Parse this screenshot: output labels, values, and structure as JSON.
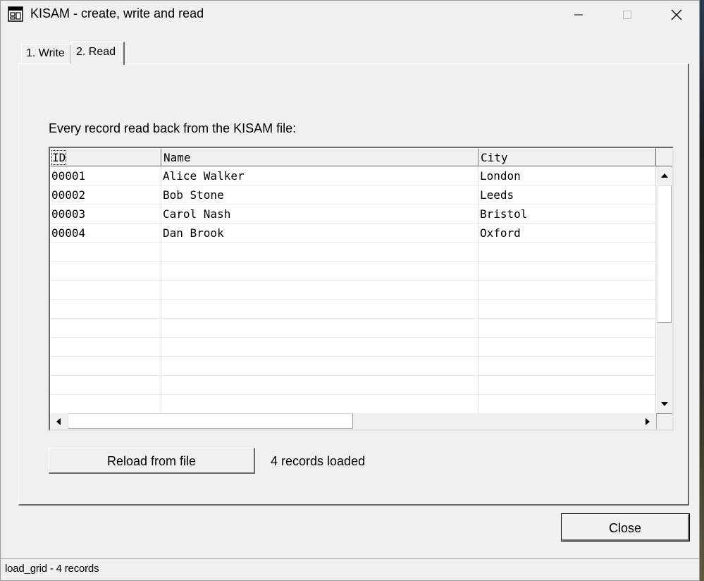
{
  "window": {
    "title": "KISAM - create, write and read"
  },
  "tabs": [
    {
      "label": "1. Write",
      "active": false
    },
    {
      "label": "2. Read",
      "active": true
    }
  ],
  "read_tab": {
    "grid_label": "Every record read back from the KISAM file:",
    "columns": [
      "ID",
      "Name",
      "City"
    ],
    "rows": [
      [
        "00001",
        "Alice Walker",
        "London"
      ],
      [
        "00002",
        "Bob Stone",
        "Leeds"
      ],
      [
        "00003",
        "Carol Nash",
        "Bristol"
      ],
      [
        "00004",
        "Dan Brook",
        "Oxford"
      ],
      [
        "",
        "",
        ""
      ],
      [
        "",
        "",
        ""
      ],
      [
        "",
        "",
        ""
      ],
      [
        "",
        "",
        ""
      ],
      [
        "",
        "",
        ""
      ],
      [
        "",
        "",
        ""
      ],
      [
        "",
        "",
        ""
      ],
      [
        "",
        "",
        ""
      ],
      [
        "",
        "",
        ""
      ]
    ],
    "reload_label": "Reload from file",
    "records_status": "4 records loaded"
  },
  "close_label": "Close",
  "status_bar": {
    "text": "load_grid - 4 records"
  },
  "icons": {
    "app": "window-form-icon",
    "minimize": "minimize-icon",
    "maximize": "maximize-icon",
    "close": "close-icon"
  }
}
